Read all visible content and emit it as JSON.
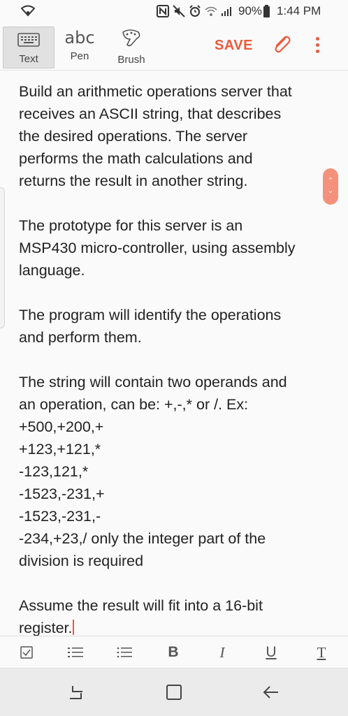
{
  "status_bar": {
    "battery": "90%",
    "time": "1:44 PM"
  },
  "toolbar": {
    "tools": [
      {
        "label": "Text",
        "icon": "keyboard-icon",
        "selected": true
      },
      {
        "label": "Pen",
        "icon_text": "abc"
      },
      {
        "label": "Brush",
        "icon": "brush-icon"
      }
    ],
    "save_label": "SAVE",
    "accent_color": "#ee5a3b"
  },
  "note": {
    "paragraphs": [
      [
        "Build an arithmetic operations server that",
        "receives an ASCII string, that describes",
        "the desired operations. The server",
        "performs the math calculations and",
        "returns the result in another string."
      ],
      [
        "The prototype for this server is an",
        "MSP430 micro-controller, using assembly",
        "language."
      ],
      [
        "The program will identify the operations",
        "and perform them."
      ],
      [
        "The string will contain two operands and",
        "an operation, can be: +,-,* or /. Ex:",
        "+500,+200,+",
        "+123,+121,*",
        "-123,121,*",
        "-1523,-231,+",
        "-1523,-231,-",
        "-234,+23,/ only the integer part of the",
        "division is required"
      ],
      [
        "Assume the result will fit into a 16-bit",
        "register."
      ]
    ]
  },
  "format_bar": [
    "checkbox-icon",
    "numbered-list-icon",
    "bullet-list-icon",
    "B",
    "I",
    "U",
    "T"
  ],
  "nav_bar": [
    "recent-apps-icon",
    "home-icon",
    "back-icon"
  ]
}
